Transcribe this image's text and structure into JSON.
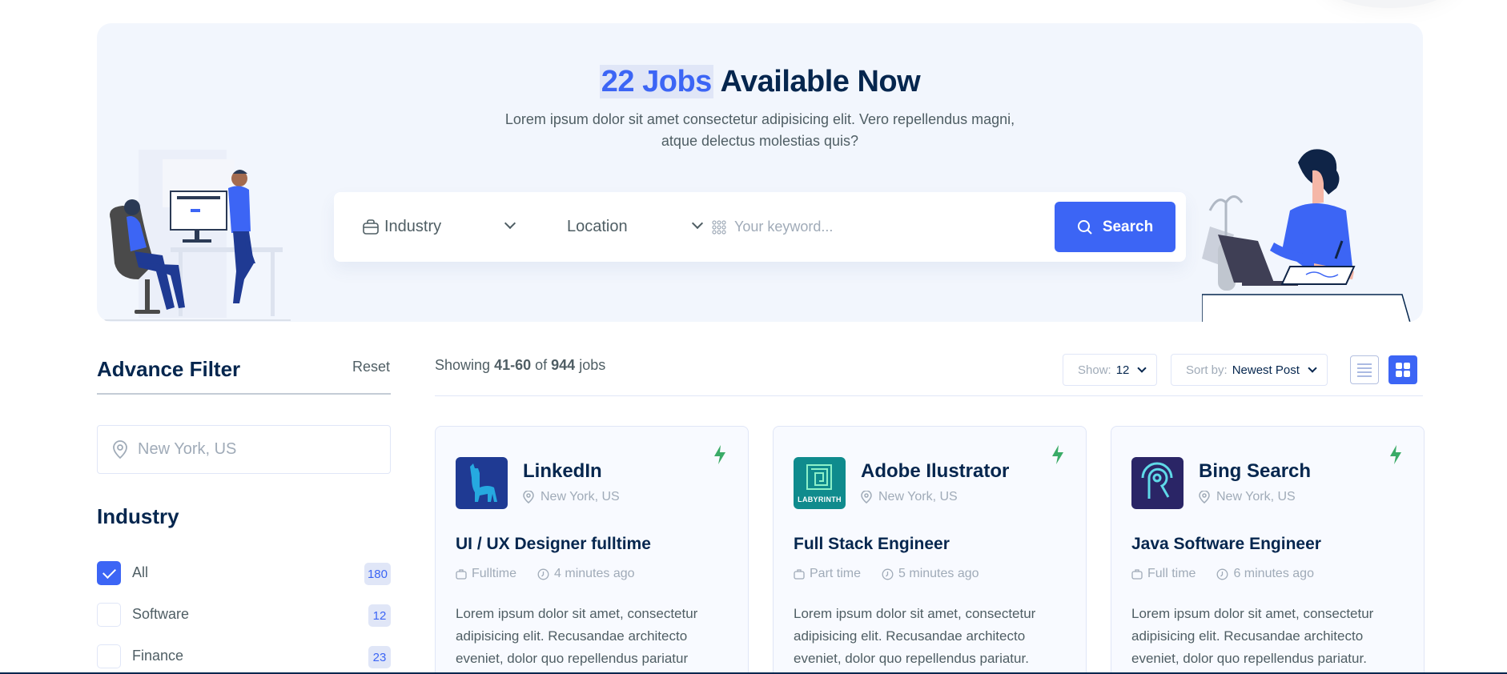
{
  "hero": {
    "title_accent": "22 Jobs",
    "title_rest": "Available Now",
    "description": "Lorem ipsum dolor sit amet consectetur adipisicing elit. Vero repellendus magni, atque delectus molestias quis?"
  },
  "search": {
    "industry_label": "Industry",
    "location_label": "Location",
    "keyword_placeholder": "Your keyword...",
    "button_label": "Search"
  },
  "filter": {
    "title": "Advance Filter",
    "reset_label": "Reset",
    "location_placeholder": "New York, US",
    "industry_title": "Industry",
    "industries": [
      {
        "label": "All",
        "count": "180",
        "checked": true
      },
      {
        "label": "Software",
        "count": "12",
        "checked": false
      },
      {
        "label": "Finance",
        "count": "23",
        "checked": false
      }
    ]
  },
  "results": {
    "showing_prefix": "Showing",
    "range": "41-60",
    "of_text": "of",
    "total": "944",
    "suffix": "jobs",
    "show_label": "Show:",
    "show_value": "12",
    "sort_label": "Sort by:",
    "sort_value": "Newest Post"
  },
  "jobs": [
    {
      "company": "LinkedIn",
      "location": "New York, US",
      "title": "UI / UX Designer fulltime",
      "type": "Fulltime",
      "posted": "4 minutes ago",
      "description": "Lorem ipsum dolor sit amet, consectetur adipisicing elit. Recusandae architecto eveniet, dolor quo repellendus pariatur",
      "logo_color": "#1F3A93",
      "logo_icon": "llama-icon"
    },
    {
      "company": "Adobe Ilustrator",
      "location": "New York, US",
      "title": "Full Stack Engineer",
      "type": "Part time",
      "posted": "5 minutes ago",
      "description": "Lorem ipsum dolor sit amet, consectetur adipisicing elit. Recusandae architecto eveniet, dolor quo repellendus pariatur.",
      "logo_color": "#0F8B8D",
      "logo_text": "LABYRINTH",
      "logo_icon": "labyrinth-icon"
    },
    {
      "company": "Bing Search",
      "location": "New York, US",
      "title": "Java Software Engineer",
      "type": "Full time",
      "posted": "6 minutes ago",
      "description": "Lorem ipsum dolor sit amet, consectetur adipisicing elit. Recusandae architecto eveniet, dolor quo repellendus pariatur.",
      "logo_color": "#2A2566",
      "logo_icon": "signal-r-icon"
    }
  ],
  "colors": {
    "brand": "#3C65F5",
    "heading": "#05264E",
    "body": "#4F5E64",
    "muted": "#A0ABB8",
    "hero_bg": "#F2F6FD",
    "flash": "#3AAB67"
  }
}
